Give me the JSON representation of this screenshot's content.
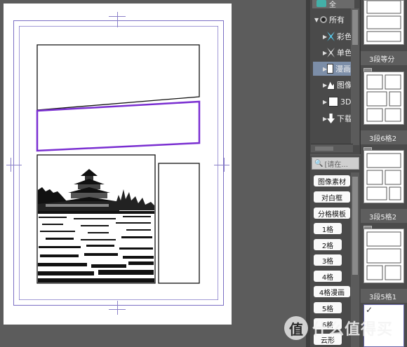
{
  "window": {
    "tab_label": "全"
  },
  "tree": {
    "root_label": "所有",
    "items": [
      {
        "label": "彩色",
        "icon": "color-icon",
        "selected": false
      },
      {
        "label": "单色",
        "icon": "mono-icon",
        "selected": false
      },
      {
        "label": "漫画",
        "icon": "manga-icon",
        "selected": true
      },
      {
        "label": "图像",
        "icon": "image-icon",
        "selected": false
      },
      {
        "label": "3D",
        "icon": "3d-icon",
        "selected": false
      },
      {
        "label": "下载",
        "icon": "download-icon",
        "selected": false
      }
    ]
  },
  "search": {
    "placeholder": "[请在..."
  },
  "tags": [
    "图像素材",
    "对白框",
    "分格模板",
    "1格",
    "2格",
    "3格",
    "4格",
    "4格漫画",
    "5格",
    "6格",
    "云形"
  ],
  "thumbnails": [
    {
      "label": "3段等分"
    },
    {
      "label": "3段6格2"
    },
    {
      "label": "3段5格2"
    },
    {
      "label": "3段5格1"
    }
  ],
  "watermark": {
    "badge": "值",
    "text": "什么值得买"
  }
}
